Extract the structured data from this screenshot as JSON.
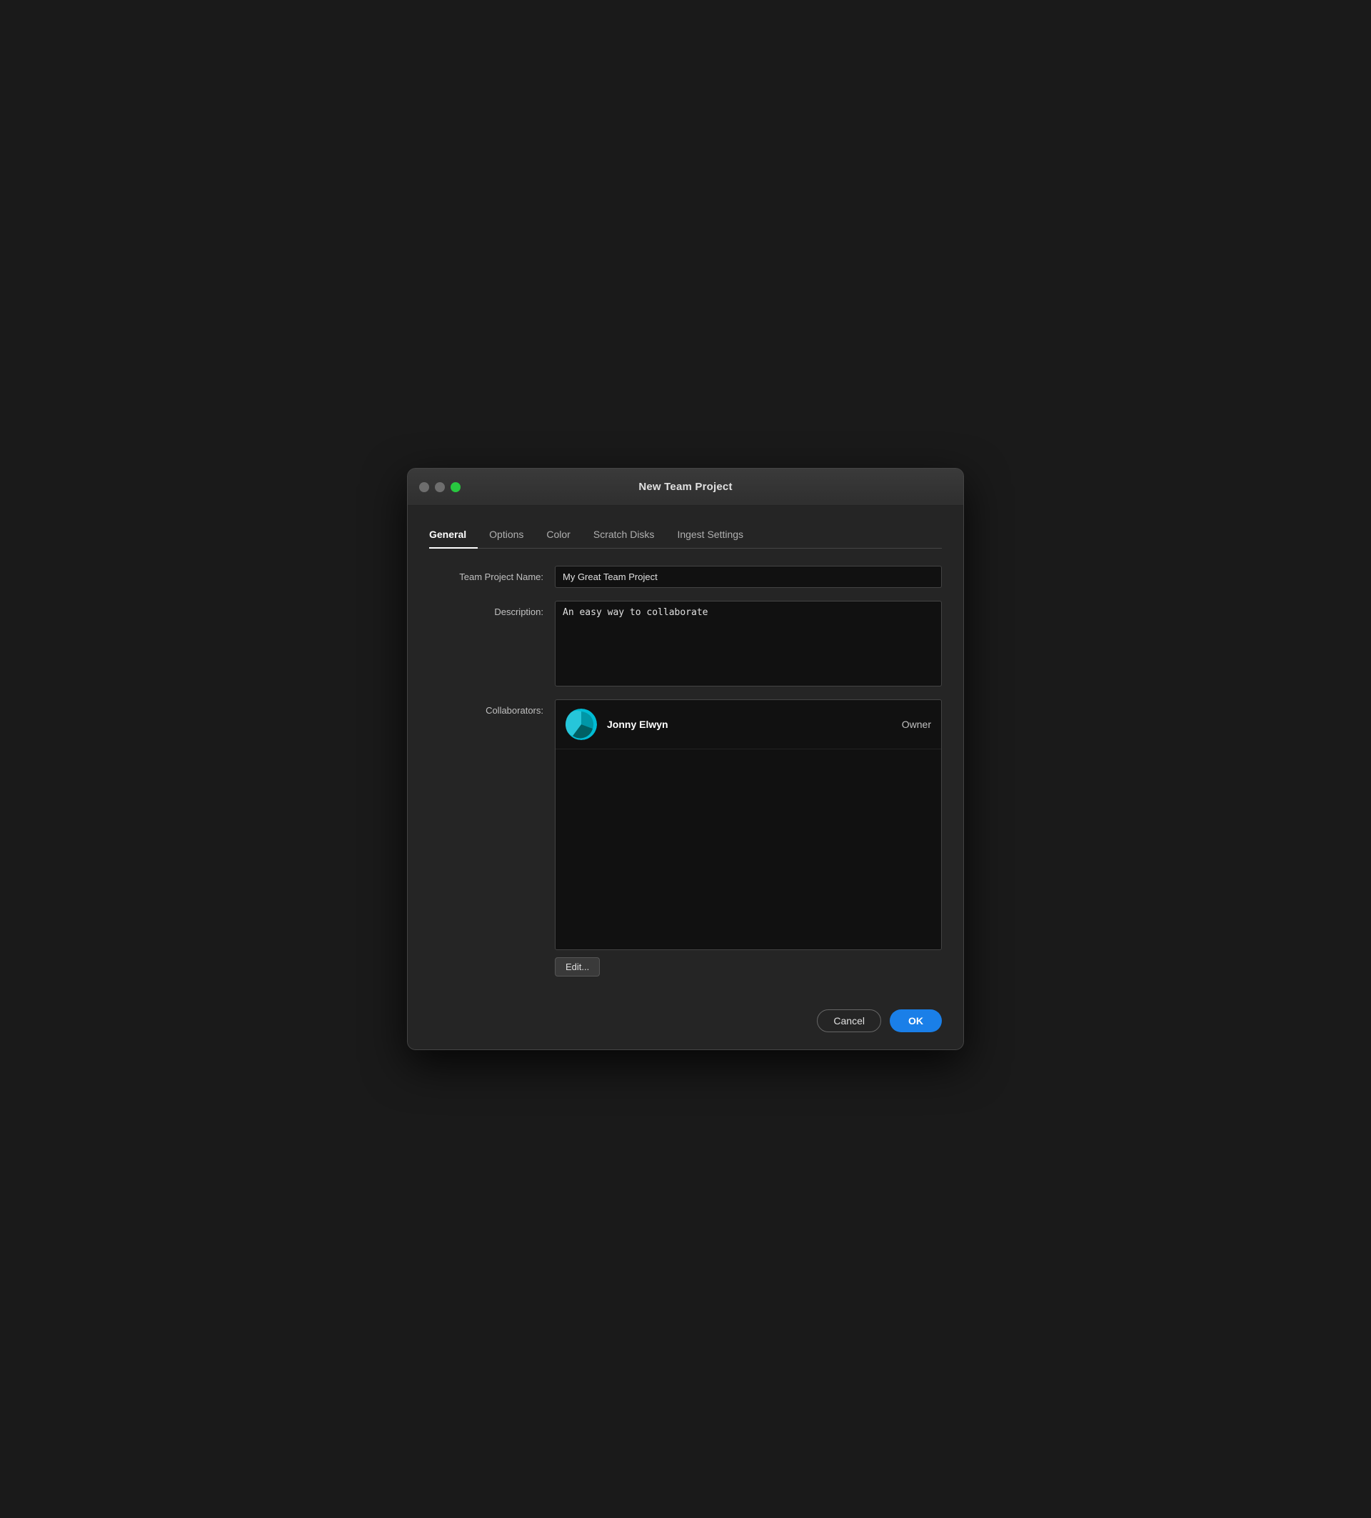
{
  "window": {
    "title": "New Team Project",
    "controls": {
      "close_label": "close",
      "minimize_label": "minimize",
      "maximize_label": "maximize"
    }
  },
  "tabs": [
    {
      "id": "general",
      "label": "General",
      "active": true
    },
    {
      "id": "options",
      "label": "Options",
      "active": false
    },
    {
      "id": "color",
      "label": "Color",
      "active": false
    },
    {
      "id": "scratch-disks",
      "label": "Scratch Disks",
      "active": false
    },
    {
      "id": "ingest-settings",
      "label": "Ingest Settings",
      "active": false
    }
  ],
  "form": {
    "project_name_label": "Team Project Name:",
    "project_name_value": "My Great Team Project",
    "description_label": "Description:",
    "description_value": "An easy way to collaborate",
    "collaborators_label": "Collaborators:",
    "collaborator": {
      "name": "Jonny Elwyn",
      "role": "Owner"
    },
    "edit_button_label": "Edit..."
  },
  "footer": {
    "cancel_label": "Cancel",
    "ok_label": "OK"
  }
}
